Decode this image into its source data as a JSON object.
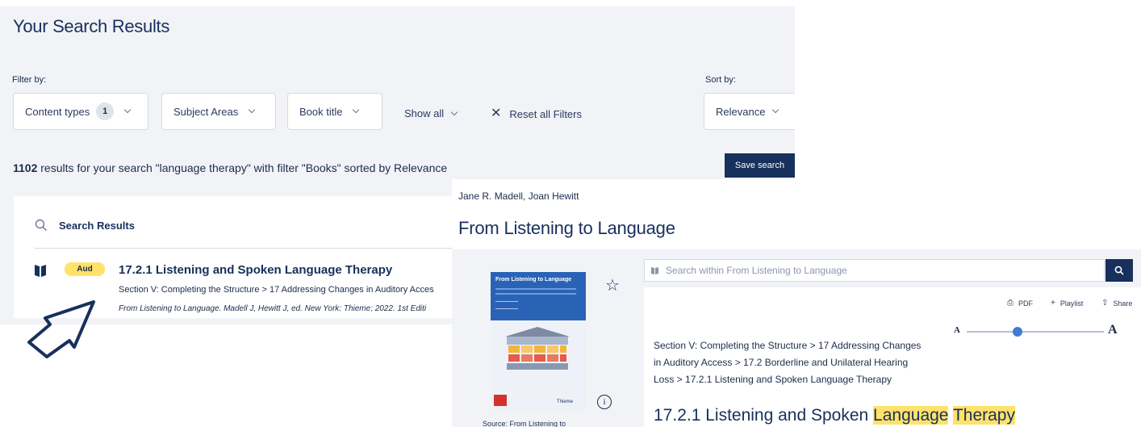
{
  "results_page": {
    "title": "Your Search Results",
    "filter_by_label": "Filter by:",
    "sort_by_label": "Sort by:",
    "filters": {
      "content_types_label": "Content types",
      "content_types_count": "1",
      "subject_areas_label": "Subject Areas",
      "book_title_label": "Book title",
      "show_all_label": "Show all",
      "reset_label": "Reset all Filters"
    },
    "sort_value": "Relevance",
    "summary": {
      "count": "1102",
      "text": " results  for your search \"language therapy\" with filter \"Books\" sorted by Relevance"
    },
    "save_search_label": "Save search",
    "results_heading": "Search Results",
    "result": {
      "badge": "Aud",
      "title": "17.2.1 Listening and Spoken Language Therapy",
      "path": "Section V: Completing the Structure > 17 Addressing Changes in Auditory Acces",
      "citation": "From Listening to Language. Madell J, Hewitt J, ed. New York: Thieme; 2022. 1st Editi"
    }
  },
  "book_page": {
    "authors": "Jane R. Madell, Joan Hewitt",
    "title": "From Listening to Language",
    "cover_title": "From Listening to Language",
    "cover_publisher": "Thieme",
    "source_caption": "Source: From Listening to",
    "search_placeholder": "Search within  From Listening to Language",
    "tools": {
      "pdf": "PDF",
      "playlist": "Playlist",
      "share": "Share"
    },
    "font_small": "A",
    "font_large": "A",
    "font_size_level": 0.37,
    "breadcrumb": "Section V: Completing the Structure > 17 Addressing Changes in Auditory Access > 17.2 Borderline and Unilateral Hearing Loss > 17.2.1 Listening and Spoken Language Therapy",
    "heading_prefix": "17.2.1 Listening and Spoken ",
    "heading_hl1": "Language",
    "heading_hl2": "Therapy"
  },
  "colors": {
    "navy": "#17305c",
    "highlight": "#ffe26a",
    "panel_bg": "#f1f3f7",
    "slider_blue": "#3f7cd0"
  }
}
